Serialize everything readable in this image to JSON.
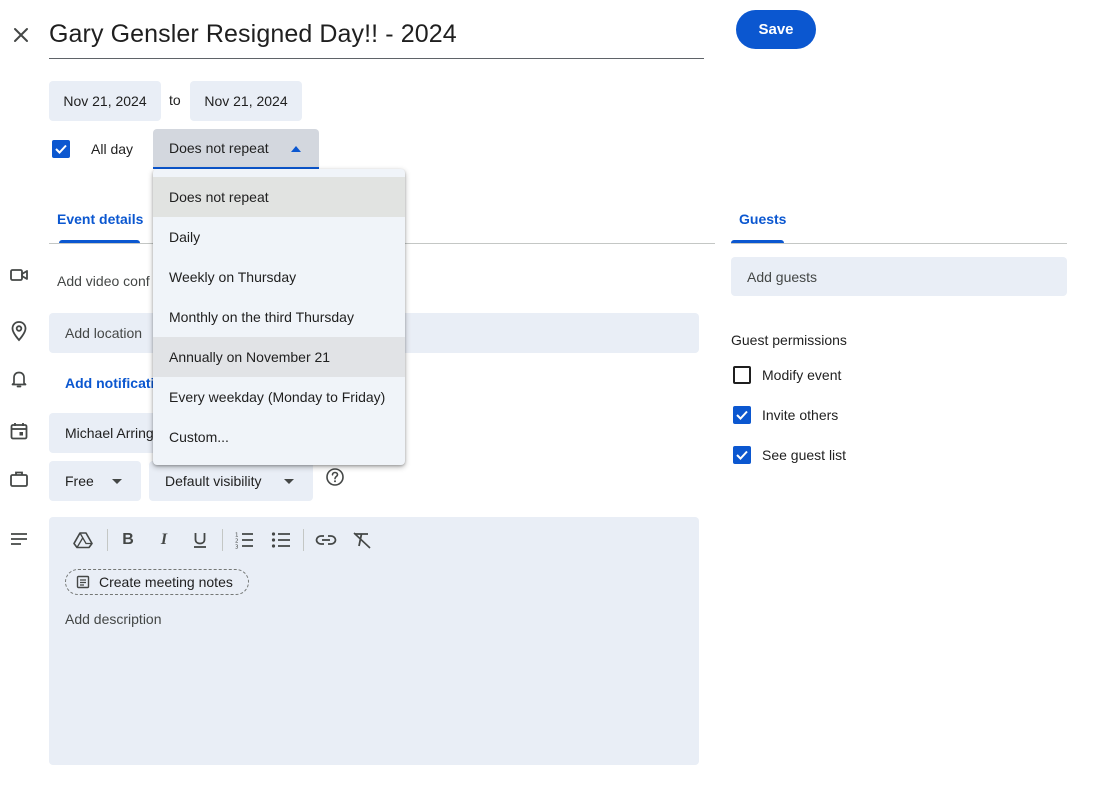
{
  "event": {
    "title": "Gary Gensler Resigned Day!! - 2024",
    "save_label": "Save"
  },
  "dates": {
    "start": "Nov 21, 2024",
    "separator": "to",
    "end": "Nov 21, 2024"
  },
  "all_day": {
    "label": "All day",
    "checked": true
  },
  "repeat": {
    "selected": "Does not repeat",
    "options": [
      "Does not repeat",
      "Daily",
      "Weekly on Thursday",
      "Monthly on the third Thursday",
      "Annually on November 21",
      "Every weekday (Monday to Friday)",
      "Custom..."
    ]
  },
  "tabs": {
    "event_details": "Event details",
    "guests": "Guests"
  },
  "details": {
    "video_conf": "Add video conf",
    "location_placeholder": "Add location",
    "notification": "Add notificati",
    "calendar_owner": "Michael Arring",
    "availability": "Free",
    "visibility": "Default visibility"
  },
  "description": {
    "meeting_notes": "Create meeting notes",
    "placeholder": "Add description"
  },
  "guests": {
    "placeholder": "Add guests",
    "permissions_title": "Guest permissions",
    "permissions": [
      {
        "label": "Modify event",
        "checked": false
      },
      {
        "label": "Invite others",
        "checked": true
      },
      {
        "label": "See guest list",
        "checked": true
      }
    ]
  },
  "colors": {
    "accent": "#0b57d0",
    "field_bg": "#e9eef6",
    "menu_bg": "#f0f4f9"
  }
}
